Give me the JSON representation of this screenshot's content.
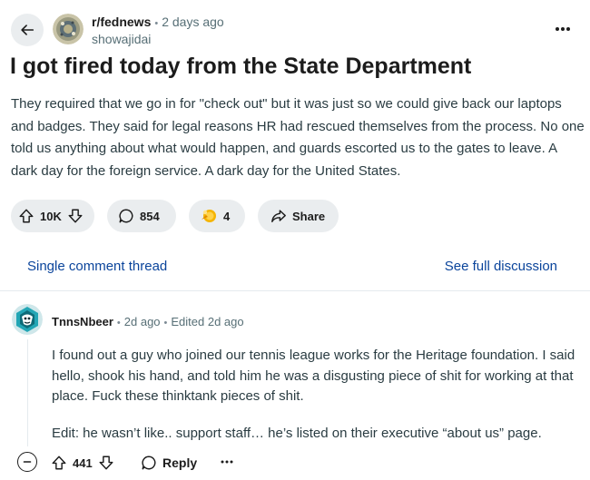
{
  "post": {
    "subreddit": "r/fednews",
    "time": "2 days ago",
    "author": "showajidai",
    "title": "I got fired today from the State Department",
    "body": "They required that we go in for \"check out\" but it was just so we could give back our laptops and badges. They said for legal reasons HR had rescued themselves from the process. No one told us anything about what would happen, and guards escorted us to the gates to leave. A dark day for the foreign service. A dark day for the United States.",
    "votes": "10K",
    "comments": "854",
    "awards": "4",
    "share_label": "Share"
  },
  "thread_nav": {
    "single_label": "Single comment thread",
    "full_label": "See full discussion"
  },
  "comment": {
    "author": "TnnsNbeer",
    "time": "2d ago",
    "edited": "Edited 2d ago",
    "paragraphs": [
      "I found out a guy who joined our tennis league works for the Heritage foundation. I said hello, shook his hand, and told him he was a disgusting piece of shit for working at that place. Fuck these thinktank pieces of shit.",
      "Edit: he wasn’t like.. support staff… he’s listed on their executive “about us” page."
    ],
    "votes": "441",
    "reply_label": "Reply"
  },
  "icons": [
    "back-arrow-icon",
    "more-icon",
    "upvote-icon",
    "downvote-icon",
    "comment-icon",
    "award-icon",
    "share-icon",
    "collapse-icon"
  ],
  "colors": {
    "pill_bg": "#eaedef",
    "link": "#0a449b",
    "text": "#1c1c1c",
    "muted": "#576f76"
  }
}
